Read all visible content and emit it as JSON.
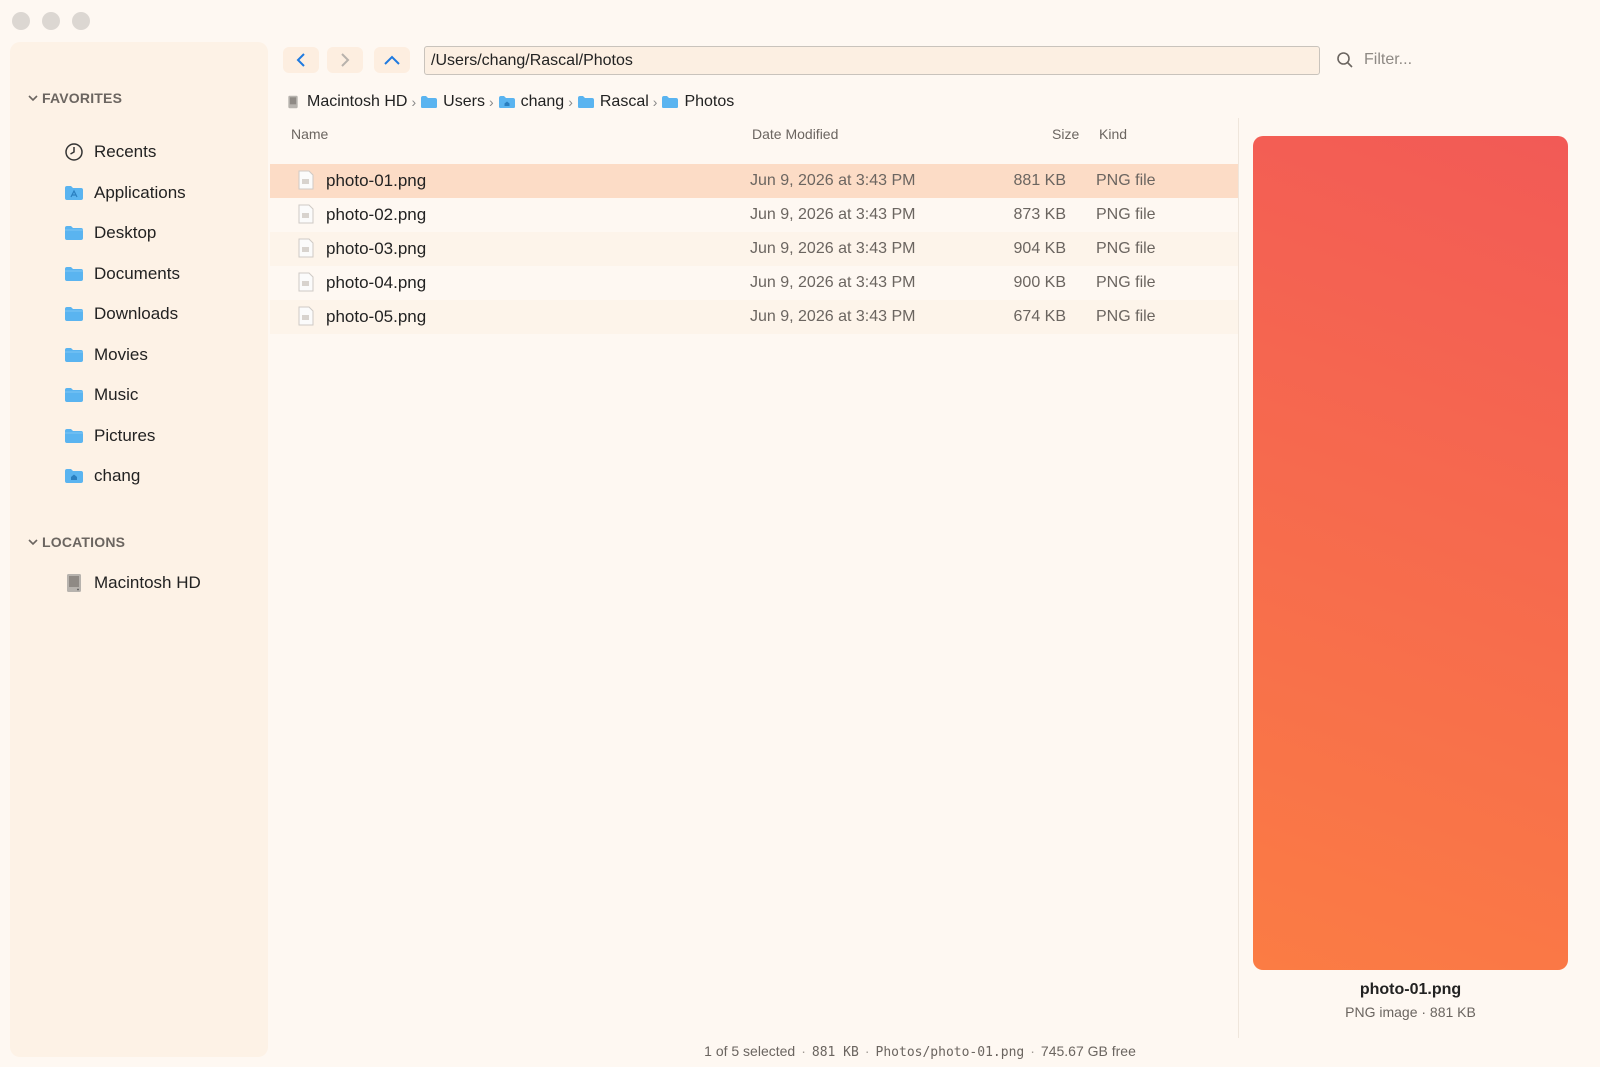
{
  "window": {
    "traffic_lights": [
      "close",
      "minimize",
      "zoom"
    ]
  },
  "sidebar": {
    "favorites_header": "FAVORITES",
    "favorites": [
      {
        "label": "Recents",
        "icon": "clock-icon"
      },
      {
        "label": "Applications",
        "icon": "applications-folder-icon"
      },
      {
        "label": "Desktop",
        "icon": "folder-icon"
      },
      {
        "label": "Documents",
        "icon": "folder-icon"
      },
      {
        "label": "Downloads",
        "icon": "folder-icon"
      },
      {
        "label": "Movies",
        "icon": "folder-icon"
      },
      {
        "label": "Music",
        "icon": "folder-icon"
      },
      {
        "label": "Pictures",
        "icon": "folder-icon"
      },
      {
        "label": "chang",
        "icon": "home-folder-icon"
      }
    ],
    "locations_header": "LOCATIONS",
    "locations": [
      {
        "label": "Macintosh HD",
        "icon": "hard-drive-icon"
      }
    ]
  },
  "toolbar": {
    "path": "/Users/chang/Rascal/Photos",
    "filter_placeholder": "Filter..."
  },
  "breadcrumb": [
    {
      "label": "Macintosh HD",
      "icon": "hard-drive-icon"
    },
    {
      "label": "Users",
      "icon": "folder-icon"
    },
    {
      "label": "chang",
      "icon": "home-folder-icon"
    },
    {
      "label": "Rascal",
      "icon": "folder-icon"
    },
    {
      "label": "Photos",
      "icon": "folder-icon"
    }
  ],
  "columns": {
    "name": "Name",
    "date": "Date Modified",
    "size": "Size",
    "kind": "Kind"
  },
  "files": [
    {
      "name": "photo-01.png",
      "date": "Jun 9, 2026 at 3:43 PM",
      "size": "881 KB",
      "kind": "PNG file",
      "selected": true
    },
    {
      "name": "photo-02.png",
      "date": "Jun 9, 2026 at 3:43 PM",
      "size": "873 KB",
      "kind": "PNG file",
      "selected": false
    },
    {
      "name": "photo-03.png",
      "date": "Jun 9, 2026 at 3:43 PM",
      "size": "904 KB",
      "kind": "PNG file",
      "selected": false
    },
    {
      "name": "photo-04.png",
      "date": "Jun 9, 2026 at 3:43 PM",
      "size": "900 KB",
      "kind": "PNG file",
      "selected": false
    },
    {
      "name": "photo-05.png",
      "date": "Jun 9, 2026 at 3:43 PM",
      "size": "674 KB",
      "kind": "PNG file",
      "selected": false
    }
  ],
  "preview": {
    "name": "photo-01.png",
    "meta": "PNG image · 881 KB",
    "gradient_colors": [
      "#f25a56",
      "#fb7c44"
    ]
  },
  "status": {
    "selection": "1 of 5 selected",
    "size": "881 KB",
    "path": "Photos/photo-01.png",
    "free": "745.67 GB free"
  },
  "colors": {
    "accent": "#1f7ae0",
    "folder": "#5ab4f0",
    "selection": "#fcdcc6",
    "window_bg": "#fef8f2",
    "sidebar_bg": "#fdf2e6"
  }
}
